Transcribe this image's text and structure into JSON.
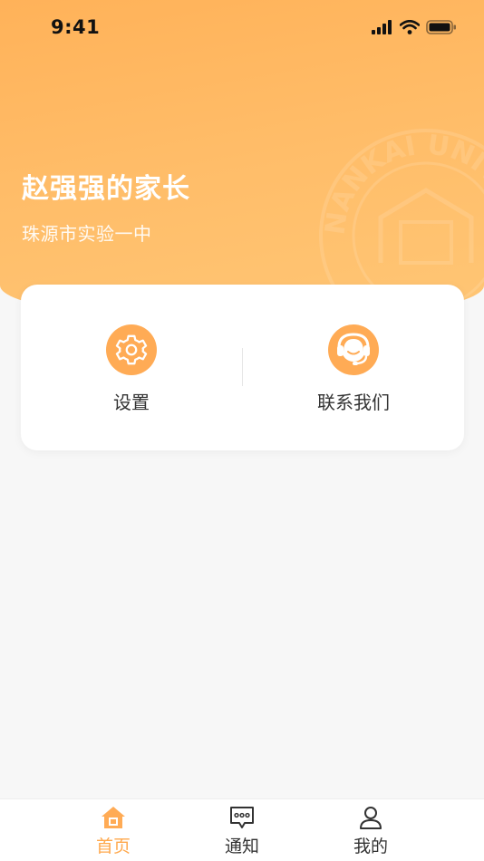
{
  "status_bar": {
    "time": "9:41"
  },
  "header": {
    "parent_name": "赵强强的家长",
    "school_name": "珠源市实验一中",
    "watermark_text": "NANKAI UNIV"
  },
  "quick_actions": [
    {
      "label": "设置",
      "icon": "gear-icon"
    },
    {
      "label": "联系我们",
      "icon": "headset-icon"
    }
  ],
  "tabbar": {
    "active": "home",
    "items": [
      {
        "id": "home",
        "label": "首页",
        "icon": "home-icon"
      },
      {
        "id": "notice",
        "label": "通知",
        "icon": "message-icon"
      },
      {
        "id": "mine",
        "label": "我的",
        "icon": "user-icon"
      }
    ]
  },
  "colors": {
    "accent": "#ffab55",
    "header_gradient_start": "#ffb259",
    "header_gradient_end": "#ffc675",
    "page_background": "#f7f7f7"
  }
}
